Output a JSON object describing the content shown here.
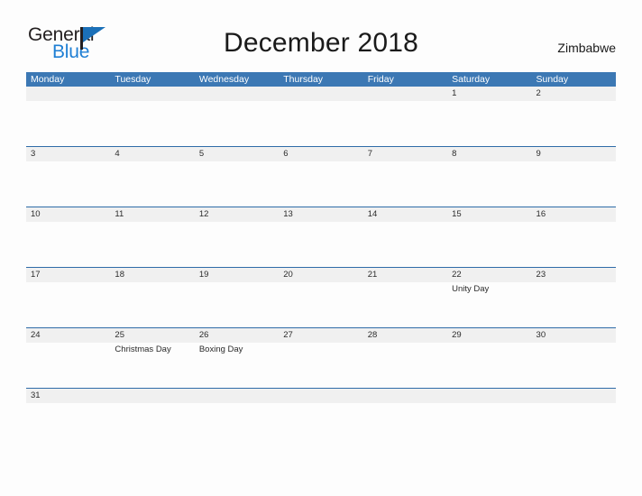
{
  "brand": {
    "name_part1": "General",
    "name_part2": "Blue",
    "flag_icon": "flag-icon",
    "color_primary": "#1b70b8",
    "color_text": "#231f20"
  },
  "header": {
    "title": "December 2018",
    "country": "Zimbabwe"
  },
  "theme": {
    "header_blue": "#3c78b4",
    "row_line_blue": "#2f6ca8",
    "date_strip_gray": "#f0f0f0",
    "page_background": "#fdfdfd",
    "text_dark": "#2b2b2b"
  },
  "calendar": {
    "month": "December",
    "year": "2018",
    "week_start": "Monday",
    "day_headers": [
      "Monday",
      "Tuesday",
      "Wednesday",
      "Thursday",
      "Friday",
      "Saturday",
      "Sunday"
    ],
    "weeks": [
      {
        "days": [
          {
            "date": "",
            "events": []
          },
          {
            "date": "",
            "events": []
          },
          {
            "date": "",
            "events": []
          },
          {
            "date": "",
            "events": []
          },
          {
            "date": "",
            "events": []
          },
          {
            "date": "1",
            "events": []
          },
          {
            "date": "2",
            "events": []
          }
        ]
      },
      {
        "days": [
          {
            "date": "3",
            "events": []
          },
          {
            "date": "4",
            "events": []
          },
          {
            "date": "5",
            "events": []
          },
          {
            "date": "6",
            "events": []
          },
          {
            "date": "7",
            "events": []
          },
          {
            "date": "8",
            "events": []
          },
          {
            "date": "9",
            "events": []
          }
        ]
      },
      {
        "days": [
          {
            "date": "10",
            "events": []
          },
          {
            "date": "11",
            "events": []
          },
          {
            "date": "12",
            "events": []
          },
          {
            "date": "13",
            "events": []
          },
          {
            "date": "14",
            "events": []
          },
          {
            "date": "15",
            "events": []
          },
          {
            "date": "16",
            "events": []
          }
        ]
      },
      {
        "days": [
          {
            "date": "17",
            "events": []
          },
          {
            "date": "18",
            "events": []
          },
          {
            "date": "19",
            "events": []
          },
          {
            "date": "20",
            "events": []
          },
          {
            "date": "21",
            "events": []
          },
          {
            "date": "22",
            "events": [
              "Unity Day"
            ]
          },
          {
            "date": "23",
            "events": []
          }
        ]
      },
      {
        "days": [
          {
            "date": "24",
            "events": []
          },
          {
            "date": "25",
            "events": [
              "Christmas Day"
            ]
          },
          {
            "date": "26",
            "events": [
              "Boxing Day"
            ]
          },
          {
            "date": "27",
            "events": []
          },
          {
            "date": "28",
            "events": []
          },
          {
            "date": "29",
            "events": []
          },
          {
            "date": "30",
            "events": []
          }
        ]
      },
      {
        "days": [
          {
            "date": "31",
            "events": []
          },
          {
            "date": "",
            "events": []
          },
          {
            "date": "",
            "events": []
          },
          {
            "date": "",
            "events": []
          },
          {
            "date": "",
            "events": []
          },
          {
            "date": "",
            "events": []
          },
          {
            "date": "",
            "events": []
          }
        ]
      }
    ],
    "holidays": [
      {
        "date": "22",
        "name": "Unity Day"
      },
      {
        "date": "25",
        "name": "Christmas Day"
      },
      {
        "date": "26",
        "name": "Boxing Day"
      }
    ]
  }
}
